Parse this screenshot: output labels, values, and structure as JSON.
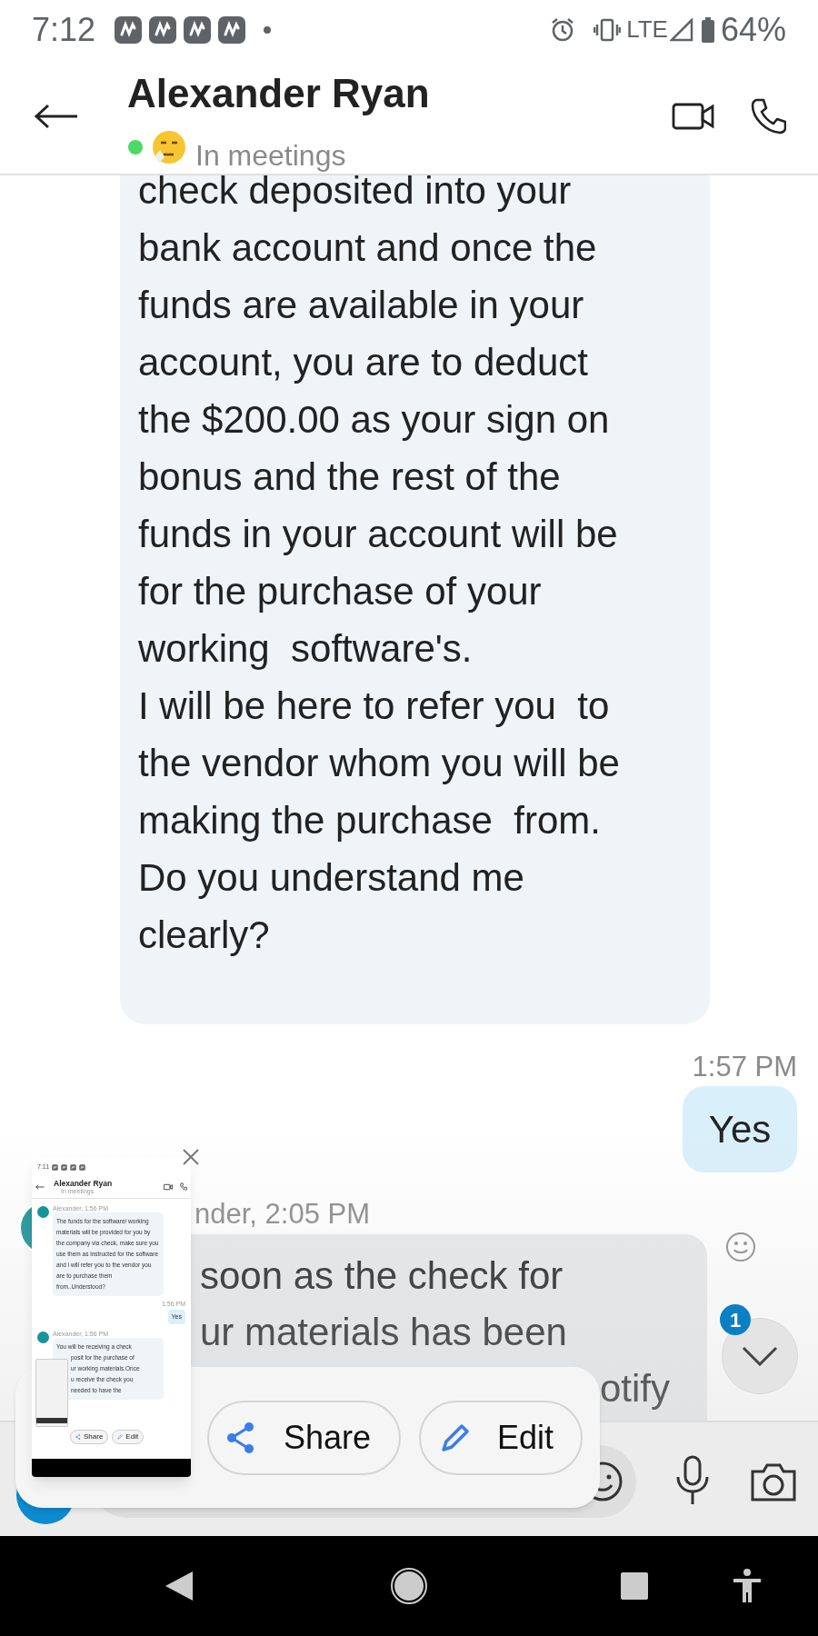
{
  "status_bar": {
    "time": "7:12",
    "network": "LTE",
    "battery": "64%"
  },
  "header": {
    "title": "Alexander Ryan",
    "status": "In meetings",
    "online": true
  },
  "messages": [
    {
      "kind": "incoming",
      "lines": [
        "check deposited into your",
        "bank account and once the",
        "funds are available in your",
        "account, you are to deduct",
        "the $200.00 as your sign on",
        "bonus and the rest of the",
        "funds in your account will be",
        "for the purchase of your",
        "working  software's.",
        "I will be here to refer you  to",
        "the vendor whom you will be",
        "making the purchase  from.",
        "Do you understand me",
        "clearly?"
      ]
    },
    {
      "kind": "outgoing",
      "time": "1:57 PM",
      "text": "Yes"
    },
    {
      "kind": "incoming",
      "sender": "nder, 2:05 PM",
      "lines": [
        "soon as the check for",
        "ur materials has been",
        "otify"
      ]
    }
  ],
  "scroll_button": {
    "badge": "1"
  },
  "screenshot_toolbar": {
    "buttons": [
      {
        "kind": "share",
        "label": "Share"
      },
      {
        "kind": "edit",
        "label": "Edit"
      }
    ]
  },
  "screenshot_preview": {
    "time": "7:11",
    "title": "Alexander Ryan",
    "status": "In meetings",
    "messages": [
      {
        "kind": "incoming",
        "sender": "Alexander, 1:56 PM",
        "lines": [
          "The funds for the software/ working materials will be provided for you by the company via check, make sure you use them as instructed for the software and i will refer you to the vendor you are to purchase them from..Understood?"
        ]
      },
      {
        "kind": "outgoing",
        "time": "1:56 PM",
        "text": "Yes"
      },
      {
        "kind": "incoming",
        "sender": "Alexander, 1:56 PM",
        "lines": [
          "You will be receiving a check",
          "posit for the purchase of",
          "ur working materials.Once",
          "u receive the check you",
          "needed to have the"
        ]
      }
    ],
    "buttons": [
      {
        "kind": "share",
        "label": "Share"
      },
      {
        "kind": "edit",
        "label": "Edit"
      }
    ]
  }
}
